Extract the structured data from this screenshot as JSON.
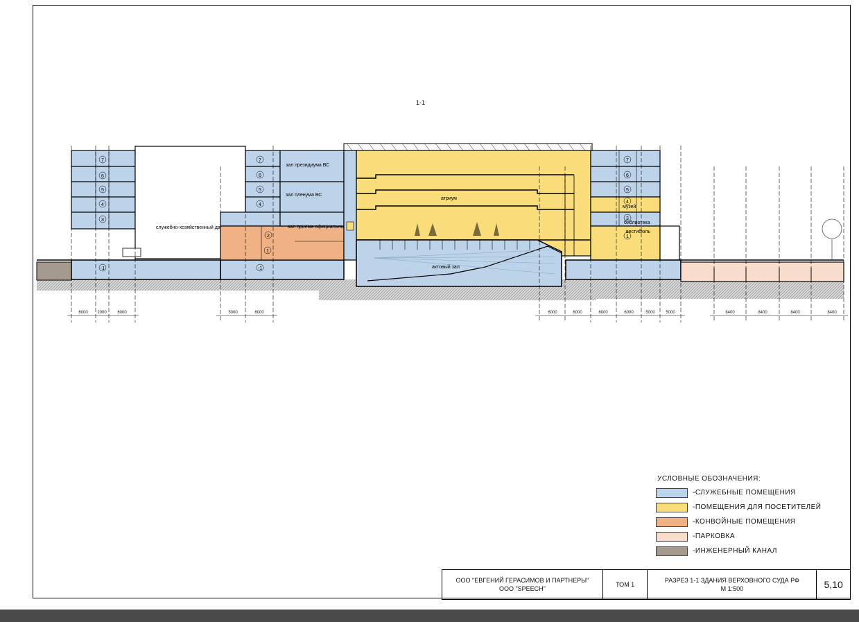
{
  "drawing": {
    "section_label": "1-1",
    "room_labels": {
      "service_yard": "служебно-хозяйственный двор",
      "presidium_hall": "зал президиума ВС",
      "plenum_hall": "зал пленума ВС",
      "delegations_hall": "зал приема официальных делегаций",
      "atrium": "атриум",
      "assembly_hall": "актовый зал",
      "museum": "музей",
      "library": "библиотека",
      "vestibule": "вестибюль"
    },
    "dimensions_left": [
      "6000",
      "2000",
      "6000"
    ],
    "dimensions_mid": [
      "5000",
      "6000"
    ],
    "dimensions_right": [
      "6000",
      "6000",
      "6000",
      "6000",
      "5000",
      "5000"
    ],
    "dimensions_parking": [
      "8400",
      "8400",
      "8400",
      "8400"
    ],
    "colors": {
      "service": "#bcd3ea",
      "visitors": "#f8dd7a",
      "convoy": "#f0b184",
      "parking": "#f8dccc",
      "engineering": "#a49a8e",
      "ground": "#c8c8c8"
    }
  },
  "legend": {
    "title": "УСЛОВНЫЕ ОБОЗНАЧЕНИЯ:",
    "items": [
      {
        "label": "-СЛУЖЕБНЫЕ ПОМЕЩЕНИЯ",
        "color": "#bcd3ea"
      },
      {
        "label": "-ПОМЕЩЕНИЯ ДЛЯ ПОСЕТИТЕЛЕЙ",
        "color": "#f8dd7a"
      },
      {
        "label": "-КОНВОЙНЫЕ ПОМЕЩЕНИЯ",
        "color": "#f0b184"
      },
      {
        "label": "-ПАРКОВКА",
        "color": "#f8dccc"
      },
      {
        "label": "-ИНЖЕНЕРНЫЙ КАНАЛ",
        "color": "#a49a8e"
      }
    ]
  },
  "titleblock": {
    "company_line1": "ООО \"ЕВГЕНИЙ ГЕРАСИМОВ И ПАРТНЕРЫ\"",
    "company_line2": "ООО \"SPEECH\"",
    "volume": "ТОМ 1",
    "description_line1": "РАЗРЕЗ 1-1 ЗДАНИЯ ВЕРХОВНОГО СУДА РФ",
    "description_line2": "М 1:500",
    "sheet_number": "5,10"
  }
}
